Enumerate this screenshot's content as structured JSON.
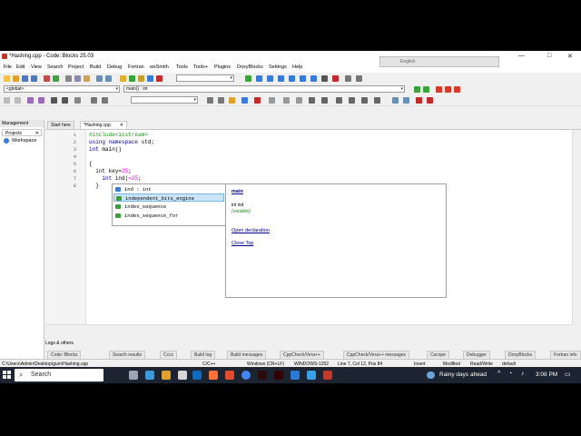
{
  "window": {
    "title": "*Hashing.cpp - Code::Blocks 25.03",
    "minimize": "—",
    "maximize": "□",
    "close": "✕"
  },
  "overlay": {
    "label": "English"
  },
  "menu": [
    "File",
    "Edit",
    "View",
    "Search",
    "Project",
    "Build",
    "Debug",
    "Fortran",
    "wxSmith",
    "Tools",
    "Tools+",
    "Plugins",
    "DoxyBlocks",
    "Settings",
    "Help"
  ],
  "toolbar": {
    "scope": "<global>",
    "symbol": "main() : int"
  },
  "management": {
    "title": "Management",
    "tab": "Projects",
    "tab_close": "✕",
    "workspace": "Workspace"
  },
  "tabs": [
    {
      "label": "Start here"
    },
    {
      "label": "*Hashing.cpp"
    }
  ],
  "tab_close": "✕",
  "editor": {
    "line_numbers": [
      "1",
      "2",
      "3",
      "4",
      "5",
      "6",
      "7",
      "8"
    ],
    "lines": [
      {
        "pre": "#include<iostream>"
      },
      {
        "kw": "using namespace",
        "txt": " std;"
      },
      {
        "kw": "int",
        "txt": " main()"
      },
      {
        "txt": ""
      },
      {
        "txt": "{"
      },
      {
        "kw": "  int",
        "txt": " key=",
        "num": "25",
        "end": ";"
      },
      {
        "kw": "    int",
        "txt": " ind",
        "cursor": "|",
        "num": "=25",
        "end": ";"
      },
      {
        "txt": "  }"
      }
    ]
  },
  "autocomplete": [
    {
      "label": "ind : int",
      "color": "#3a7bd5"
    },
    {
      "label": "independent_bits_engine",
      "color": "#3f9b3f",
      "selected": true
    },
    {
      "label": "index_sequence",
      "color": "#3f9b3f"
    },
    {
      "label": "index_sequence_for",
      "color": "#3f9b3f"
    }
  ],
  "docpanel": {
    "title": "main",
    "signature": "int ind",
    "kind": "(variable)",
    "open": "Open declaration",
    "close": "Close Top"
  },
  "logs": {
    "title": "Logs & others",
    "tabs": [
      "Code::Blocks",
      "Search results",
      "Cccc",
      "Build log",
      "Build messages",
      "CppCheck/Vera++",
      "CppCheck/Vera++ messages",
      "Cscope",
      "Debugger",
      "DoxyBlocks",
      "Fortran info"
    ]
  },
  "status": {
    "path": "C:\\Users\\Admin\\Desktop\\gum\\Hashing.cpp",
    "lang": "C/C++",
    "eol": "Windows (CR+LF)",
    "enc": "WINDOWS-1252",
    "pos": "Line 7, Col 12, Pos 84",
    "mode": "Insert",
    "modified": "Modified",
    "rw": "Read/Write",
    "profile": "default"
  },
  "taskbar": {
    "search": "Search",
    "weather": "Rainy days ahead",
    "time": "3:08 PM"
  },
  "colors": {
    "keyword": "#00008b",
    "preprocessor": "#228b22",
    "number": "#f000f0",
    "selection": "#cce4f7",
    "taskbar": "#1c2331"
  }
}
